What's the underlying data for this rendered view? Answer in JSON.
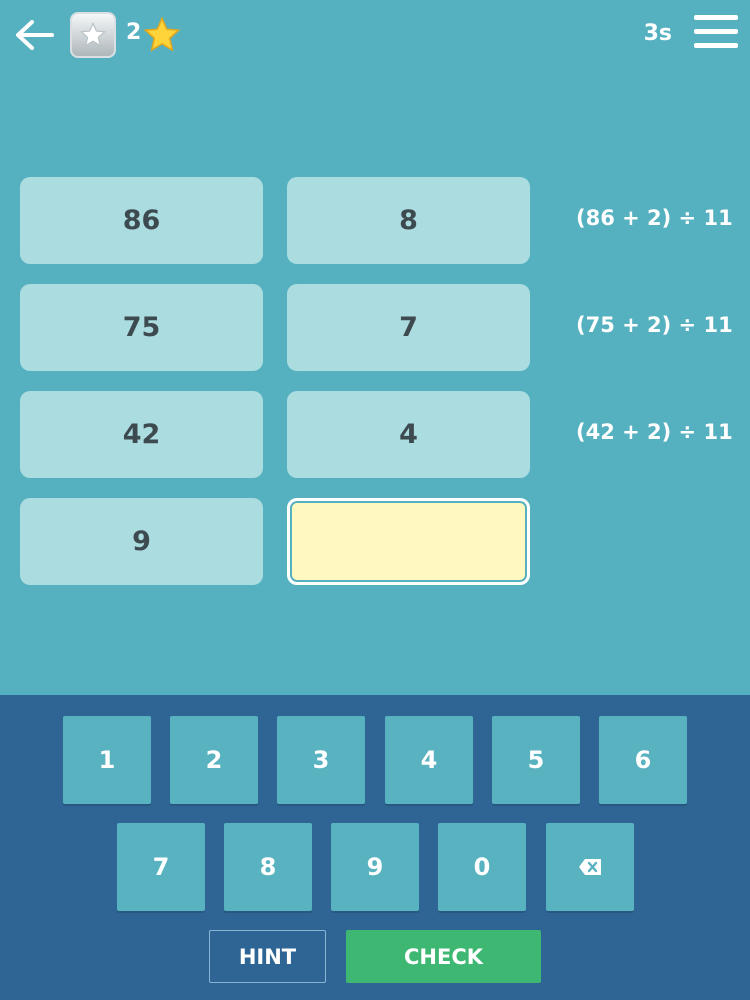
{
  "header": {
    "stars_count": "2",
    "timer": "3s"
  },
  "grid": {
    "rows": [
      {
        "left": "86",
        "right": "8",
        "formula": "(86 + 2) ÷ 11"
      },
      {
        "left": "75",
        "right": "7",
        "formula": "(75 + 2) ÷ 11"
      },
      {
        "left": "42",
        "right": "4",
        "formula": "(42 + 2) ÷ 11"
      },
      {
        "left": "9",
        "right": "",
        "formula": ""
      }
    ]
  },
  "keypad": {
    "keys_row1": [
      "1",
      "2",
      "3",
      "4",
      "5",
      "6"
    ],
    "keys_row2": [
      "7",
      "8",
      "9",
      "0"
    ],
    "backspace_icon": "backspace-icon",
    "hint_label": "HINT",
    "check_label": "CHECK"
  },
  "colors": {
    "background": "#55b1bf",
    "cell": "#aadce0",
    "active_cell": "#fff8c1",
    "keypad_bg": "#2e6595",
    "check_button": "#3db772"
  }
}
